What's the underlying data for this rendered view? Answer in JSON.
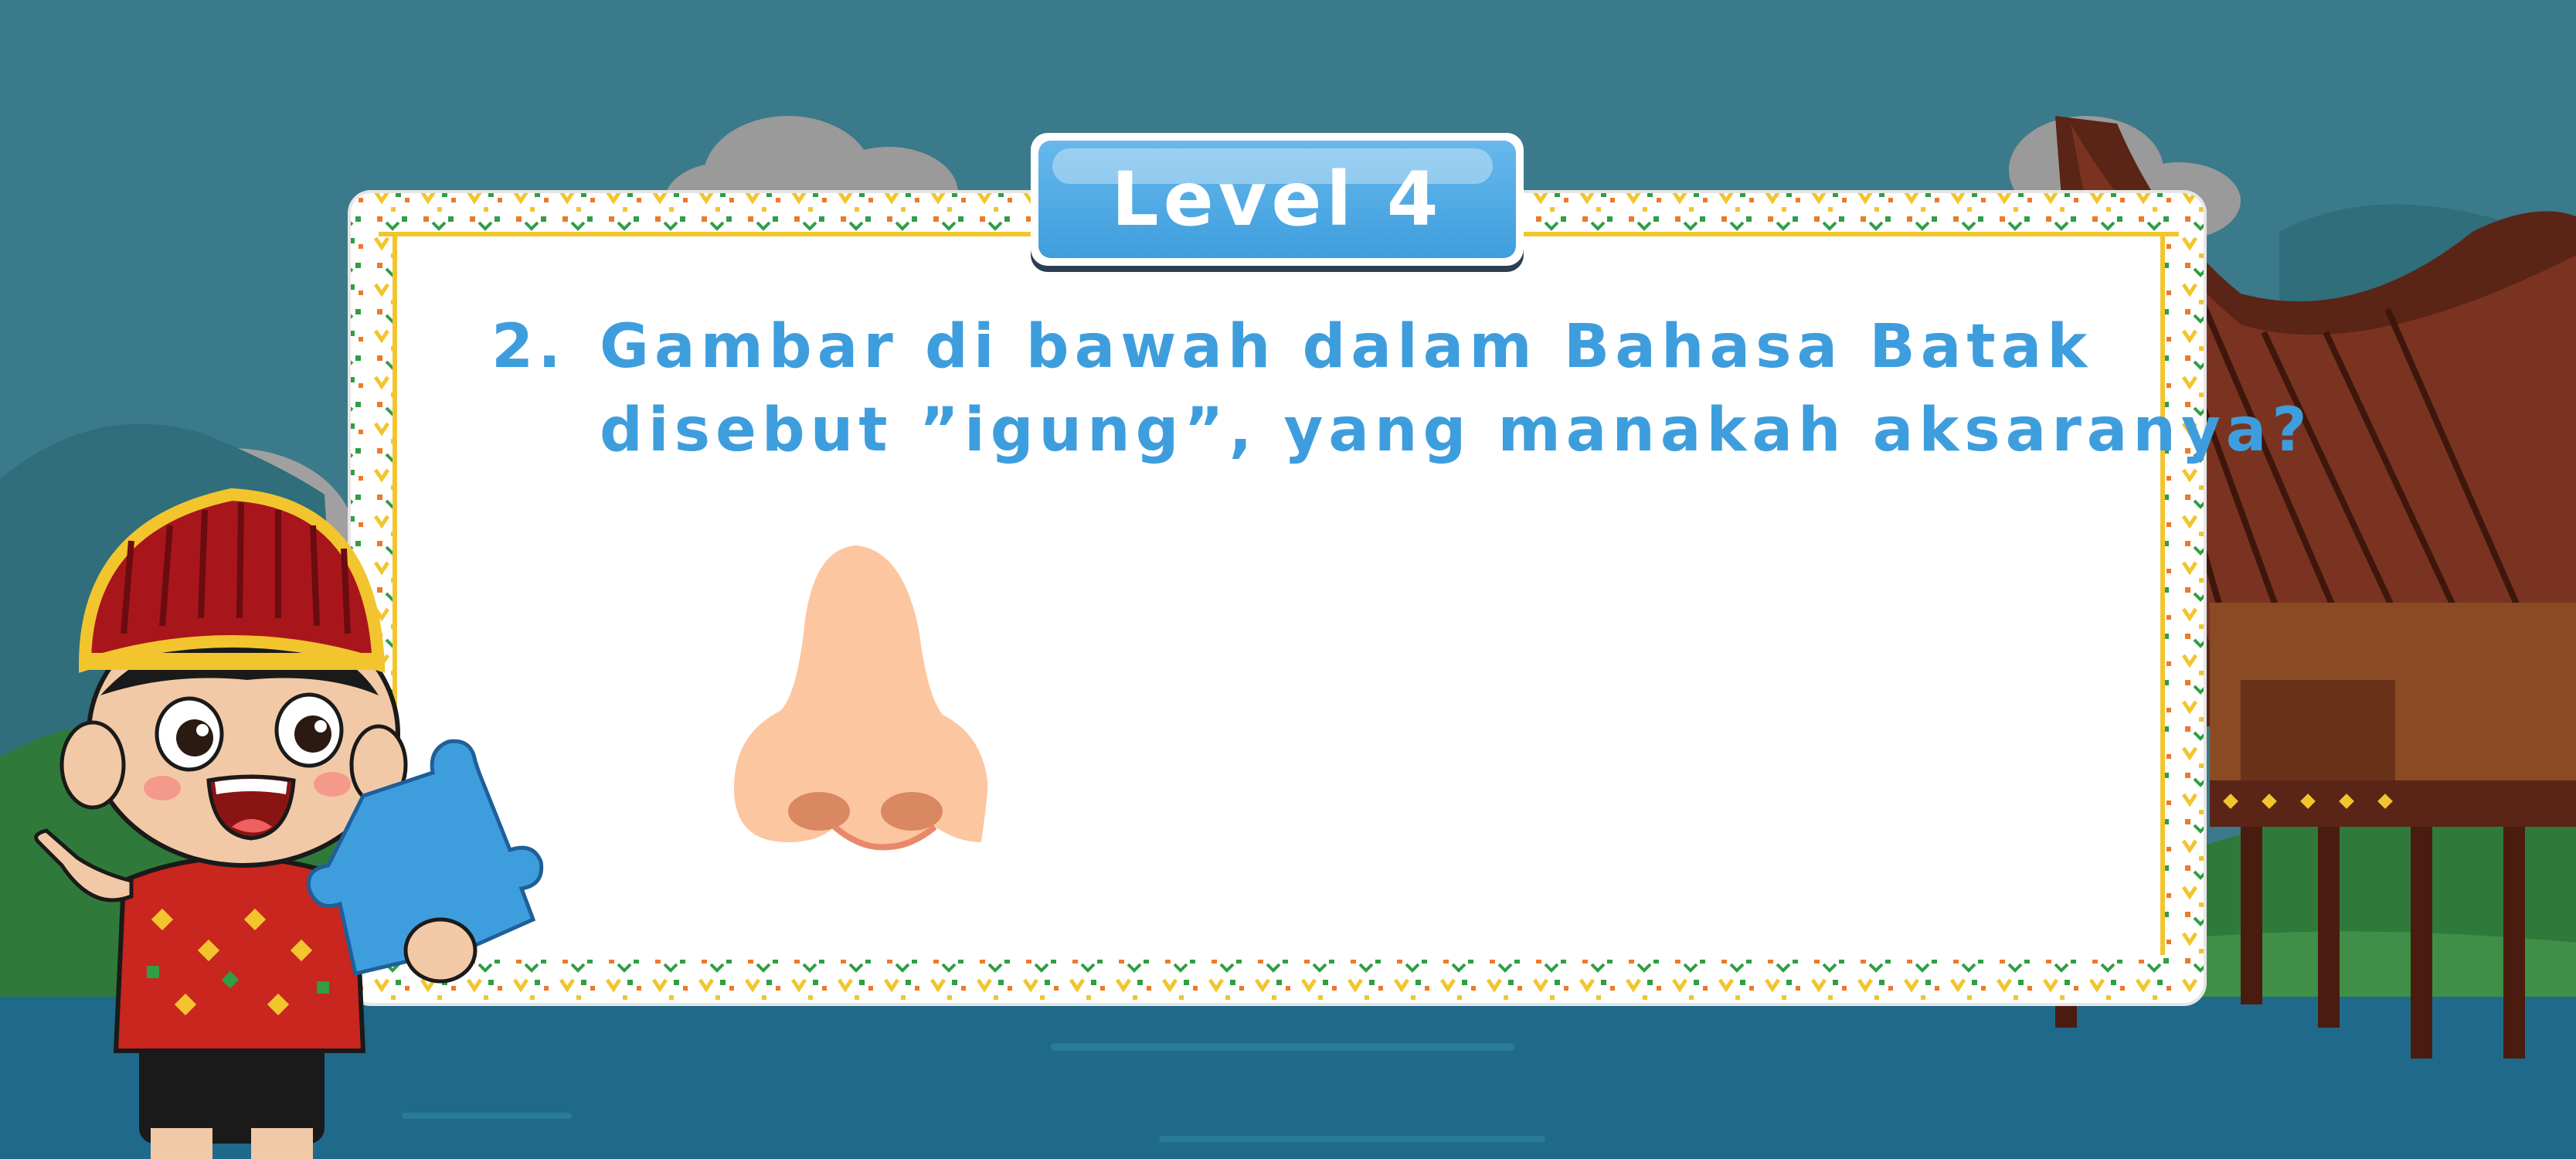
{
  "level": {
    "label": "Level 4"
  },
  "question": {
    "number": "2.",
    "line1": "Gambar di bawah dalam Bahasa Batak",
    "line2": "disebut ”igung”, yang manakah aksaranya?"
  },
  "colors": {
    "sky": "#3a7a8a",
    "water": "#1f6a8a",
    "accent_blue": "#3e9edd",
    "border_yellow": "#f2c52e",
    "border_green": "#2f9e44",
    "border_orange": "#ec7a2a",
    "nose_skin": "#fcc6a0"
  },
  "icons": {
    "picture": "nose-illustration",
    "character": "batak-boy-character",
    "puzzle": "puzzle-piece-icon",
    "house": "batak-house"
  }
}
